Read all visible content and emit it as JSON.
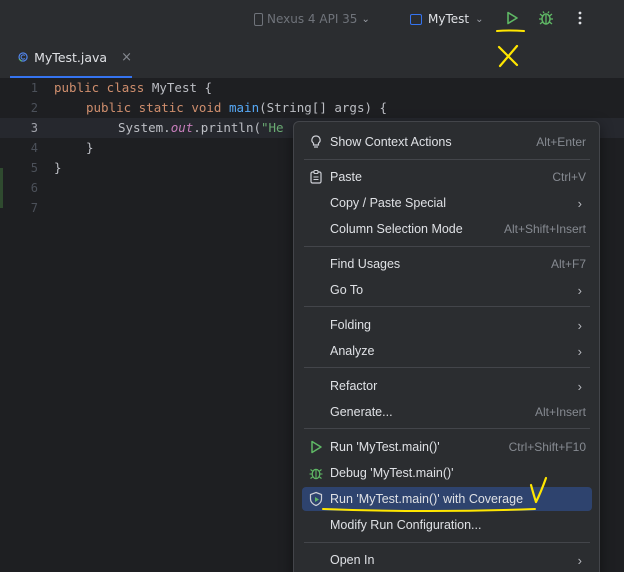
{
  "toolbar": {
    "device_label": "Nexus 4 API 35",
    "run_config_label": "MyTest",
    "icons": {
      "device": "phone-icon",
      "run": "run-icon",
      "debug": "debug-icon",
      "more": "more-vertical-icon"
    }
  },
  "tabs": [
    {
      "label": "MyTest.java",
      "close": "×"
    }
  ],
  "editor": {
    "line_numbers": [
      "1",
      "2",
      "3",
      "4",
      "5",
      "6",
      "7"
    ],
    "current_line": "3",
    "code": {
      "l1_kw": "public class",
      "l1_rest": " MyTest {",
      "l2_kw": "public static void",
      "l2_fn": "main",
      "l2_rest": "(String[] args) {",
      "l3_a": "System.",
      "l3_field": "out",
      "l3_b": ".println(",
      "l3_str": "\"He",
      "l4": "}",
      "l5": "}"
    }
  },
  "context_menu": {
    "items": {
      "show_context_actions": {
        "label": "Show Context Actions",
        "shortcut": "Alt+Enter"
      },
      "paste": {
        "label": "Paste",
        "shortcut": "Ctrl+V"
      },
      "copy_paste_special": {
        "label": "Copy / Paste Special"
      },
      "column_selection_mode": {
        "label": "Column Selection Mode",
        "shortcut": "Alt+Shift+Insert"
      },
      "find_usages": {
        "label": "Find Usages",
        "shortcut": "Alt+F7"
      },
      "go_to": {
        "label": "Go To"
      },
      "folding": {
        "label": "Folding"
      },
      "analyze": {
        "label": "Analyze"
      },
      "refactor": {
        "label": "Refactor"
      },
      "generate": {
        "label": "Generate...",
        "shortcut": "Alt+Insert"
      },
      "run": {
        "label": "Run 'MyTest.main()'",
        "shortcut": "Ctrl+Shift+F10"
      },
      "debug": {
        "label": "Debug 'MyTest.main()'"
      },
      "run_coverage": {
        "label": "Run 'MyTest.main()' with Coverage"
      },
      "modify_run_config": {
        "label": "Modify Run Configuration..."
      },
      "open_in": {
        "label": "Open In"
      }
    },
    "submenu_arrow": "›",
    "selected_item": "run_coverage"
  },
  "colors": {
    "background": "#1e1f22",
    "panel": "#2b2d30",
    "accent_blue": "#3574f0",
    "selection": "#2e436e",
    "run_green": "#5fb865",
    "annotation_yellow": "#ffe600"
  }
}
